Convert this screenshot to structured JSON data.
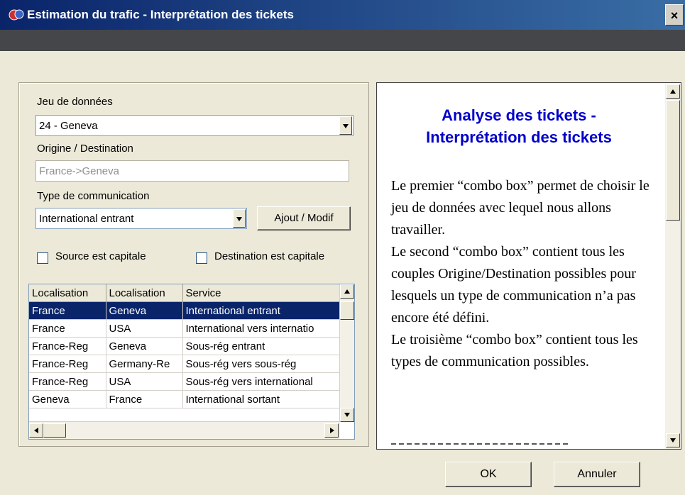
{
  "window": {
    "title": "Estimation du trafic - Interprétation des tickets",
    "close_label": "×"
  },
  "form": {
    "dataset_label": "Jeu de données",
    "dataset_value": "24 - Geneva",
    "od_label": "Origine / Destination",
    "od_value": "France->Geneva",
    "comm_label": "Type de communication",
    "comm_value": "International entrant",
    "add_button": "Ajout / Modif",
    "source_capital_label": "Source est capitale",
    "dest_capital_label": "Destination est capitale"
  },
  "grid": {
    "columns": [
      "Localisation",
      "Localisation",
      "Service"
    ],
    "rows": [
      [
        "France",
        "Geneva",
        "International entrant"
      ],
      [
        "France",
        "USA",
        "International vers internatio"
      ],
      [
        "France-Reg",
        "Geneva",
        "Sous-rég entrant"
      ],
      [
        "France-Reg",
        "Germany-Re",
        "Sous-rég vers sous-rég"
      ],
      [
        "France-Reg",
        "USA",
        "Sous-rég vers international"
      ],
      [
        "Geneva",
        "France",
        "International sortant"
      ]
    ]
  },
  "help": {
    "title_line1": "Analyse des tickets -",
    "title_line2": "Interprétation des tickets",
    "paragraphs": [
      "Le premier “combo box” permet de choisir le jeu de données avec lequel nous allons travailler.",
      "Le second “combo box” contient tous les couples Origine/Destination possibles pour lesquels un type de communication n’a pas encore été défini.",
      "Le troisième “combo box” contient tous les types de communication possibles."
    ]
  },
  "buttons": {
    "ok": "OK",
    "cancel": "Annuler"
  },
  "colors": {
    "title_gradient_start": "#0a246a",
    "help_title": "#0000cc",
    "selection": "#0a246a"
  }
}
